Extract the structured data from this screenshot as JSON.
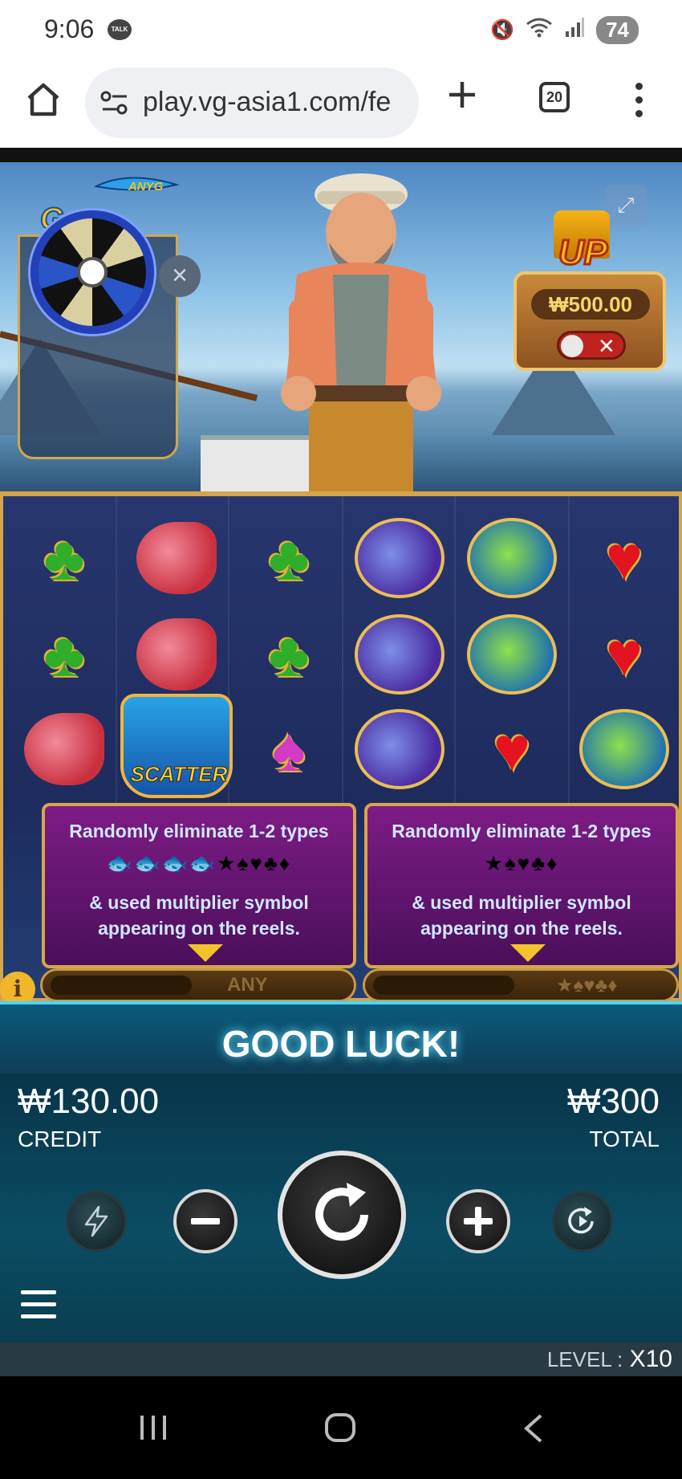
{
  "status_bar": {
    "time": "9:06",
    "talk_badge": "TALK",
    "battery": "74",
    "icons": [
      "mute-icon",
      "wifi-icon",
      "signal-icon"
    ]
  },
  "browser": {
    "url": "play.vg-asia1.com/fe",
    "tab_count": "20",
    "icons": [
      "home-icon",
      "site-settings-icon",
      "new-tab-icon",
      "tabs-icon",
      "more-menu-icon"
    ]
  },
  "game": {
    "logo": {
      "text": "Go",
      "subtitle": "ANYG"
    },
    "up_panel": {
      "label": "UP",
      "amount": "₩500.00",
      "toggle_state": "off"
    },
    "reels": {
      "grid": [
        [
          "club",
          "red-fish",
          "club",
          "marlin",
          "mahi-mahi",
          "heart"
        ],
        [
          "club",
          "red-fish",
          "club",
          "marlin",
          "mahi-mahi",
          "heart"
        ],
        [
          "red-fish",
          "scatter",
          "spade",
          "marlin",
          "heart",
          "mahi-mahi"
        ]
      ],
      "scatter_label": "SCATTER"
    },
    "info_boxes": [
      {
        "line1": "Randomly eliminate 1-2 types",
        "symbols": "🐟🐟🐟🐟★♠♥♣♦",
        "line2a": "& used multiplier symbol",
        "line2b": "appearing on the reels.",
        "meter_label": "ANY"
      },
      {
        "line1": "Randomly eliminate 1-2 types",
        "symbols": "★♠♥♣♦",
        "line2a": "& used multiplier symbol",
        "line2b": "appearing on the reels.",
        "meter_label": "★♠♥♣♦"
      }
    ],
    "message": "GOOD LUCK!",
    "credit": {
      "value": "₩130.00",
      "label": "CREDIT"
    },
    "total": {
      "value": "₩300",
      "label": "TOTAL"
    },
    "controls": [
      "turbo-button",
      "decrease-bet-button",
      "spin-button",
      "increase-bet-button",
      "autoplay-button",
      "menu-button"
    ],
    "level": {
      "label": "LEVEL :",
      "value": "X10"
    }
  },
  "android_nav": [
    "recents-button",
    "home-button",
    "back-button"
  ],
  "colors": {
    "frame_gold": "#d6a44c",
    "reel_bg": "#27366e",
    "info_purple": "#7d1c86",
    "panel_teal": "#0b4d63",
    "glow": "#47d7ff"
  }
}
